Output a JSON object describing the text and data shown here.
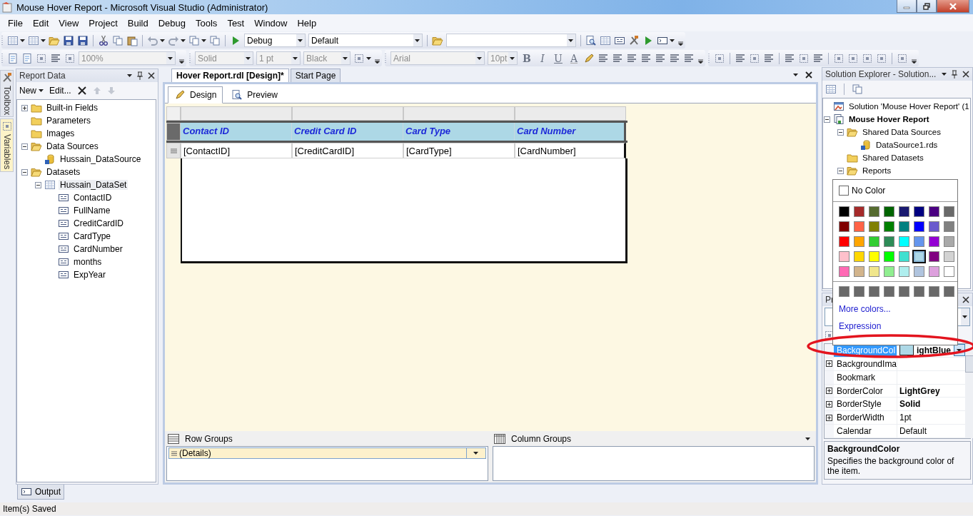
{
  "window": {
    "title": "Mouse Hover Report - Microsoft Visual Studio (Administrator)"
  },
  "menu": [
    "File",
    "Edit",
    "View",
    "Project",
    "Build",
    "Debug",
    "Tools",
    "Test",
    "Window",
    "Help"
  ],
  "toolbar": {
    "combos": [
      {
        "value": "Debug",
        "disabled": false
      },
      {
        "value": "Default",
        "disabled": false
      },
      {
        "value": "100%",
        "disabled": true
      },
      {
        "value": "Solid",
        "disabled": true
      },
      {
        "value": "1 pt",
        "disabled": true
      },
      {
        "value": "Black",
        "disabled": true
      },
      {
        "value": "Arial",
        "disabled": true
      },
      {
        "value": "10pt",
        "disabled": true
      }
    ],
    "format_buttons": [
      {
        "label": "B",
        "kind": "bold"
      },
      {
        "label": "I",
        "kind": "italic"
      },
      {
        "label": "U",
        "kind": "underline"
      },
      {
        "label": "A",
        "kind": "color"
      }
    ]
  },
  "side_tabs": [
    {
      "label": "Toolbox",
      "selected": false
    },
    {
      "label": "Variables",
      "selected": true
    }
  ],
  "report_data": {
    "title": "Report Data",
    "actions": [
      {
        "label": "New",
        "dropdown": true
      },
      {
        "label": "Edit...",
        "dropdown": false
      }
    ],
    "tree": [
      {
        "label": "Built-in Fields",
        "kind": "folder",
        "expanded": false,
        "selected": false
      },
      {
        "label": "Parameters",
        "kind": "folder",
        "selected": false
      },
      {
        "label": "Images",
        "kind": "folder",
        "selected": false
      },
      {
        "label": "Data Sources",
        "kind": "openfolder",
        "expanded": true,
        "selected": false,
        "children": [
          {
            "label": "Hussain_DataSource",
            "kind": "datasource",
            "selected": false
          }
        ]
      },
      {
        "label": "Datasets",
        "kind": "openfolder",
        "expanded": true,
        "selected": false,
        "children": [
          {
            "label": "Hussain_DataSet",
            "kind": "dataset",
            "expanded": true,
            "selected": true,
            "children": [
              {
                "label": "ContactID",
                "kind": "field",
                "selected": false
              },
              {
                "label": "FullName",
                "kind": "field",
                "selected": false
              },
              {
                "label": "CreditCardID",
                "kind": "field",
                "selected": false
              },
              {
                "label": "CardType",
                "kind": "field",
                "selected": false
              },
              {
                "label": "CardNumber",
                "kind": "field",
                "selected": false
              },
              {
                "label": "months",
                "kind": "field",
                "selected": false
              },
              {
                "label": "ExpYear",
                "kind": "field",
                "selected": false
              }
            ]
          }
        ]
      }
    ]
  },
  "document": {
    "tabs": [
      {
        "label": "Hover Report.rdl [Design]*",
        "selected": true
      },
      {
        "label": "Start Page",
        "selected": false
      }
    ],
    "view_tabs": [
      {
        "label": "Design",
        "selected": true
      },
      {
        "label": "Preview",
        "selected": false
      }
    ],
    "table": {
      "columns": [
        {
          "header": "Contact ID",
          "field": "[ContactID]"
        },
        {
          "header": "Credit Card ID",
          "field": "[CreditCardID]"
        },
        {
          "header": "Card Type",
          "field": "[CardType]"
        },
        {
          "header": "Card Number",
          "field": "[CardNumber]"
        }
      ]
    },
    "row_groups": {
      "title": "Row Groups",
      "items": [
        "(Details)"
      ]
    },
    "column_groups": {
      "title": "Column Groups"
    }
  },
  "solution_explorer": {
    "title": "Solution Explorer - Solution...",
    "tree": [
      {
        "label": "Solution 'Mouse Hover Report' (1",
        "kind": "solution",
        "selected": false
      },
      {
        "label": "Mouse Hover Report",
        "kind": "project",
        "expanded": true,
        "selected": false,
        "children": [
          {
            "label": "Shared Data Sources",
            "kind": "openfolder",
            "expanded": true,
            "selected": false,
            "children": [
              {
                "label": "DataSource1.rds",
                "kind": "database",
                "selected": false
              }
            ]
          },
          {
            "label": "Shared Datasets",
            "kind": "folder",
            "selected": false
          },
          {
            "label": "Reports",
            "kind": "openfolder",
            "expanded": true,
            "selected": false
          }
        ]
      }
    ]
  },
  "properties": {
    "title": "Pr",
    "rows": [
      {
        "name": "BackgroundCol",
        "value": "ightBlue",
        "kind": "color",
        "color": "#add8e6",
        "bold": true,
        "expandable": false,
        "selected": true
      },
      {
        "name": "BackgroundIma",
        "kind": "text",
        "expandable": true,
        "selected": false
      },
      {
        "name": "Bookmark",
        "kind": "text",
        "expandable": false,
        "selected": false
      },
      {
        "name": "BorderColor",
        "value": "LightGrey",
        "kind": "text",
        "bold": true,
        "expandable": true,
        "selected": false
      },
      {
        "name": "BorderStyle",
        "value": "Solid",
        "kind": "text",
        "bold": true,
        "expandable": true,
        "selected": false
      },
      {
        "name": "BorderWidth",
        "value": "1pt",
        "kind": "text",
        "bold": false,
        "expandable": true,
        "selected": false
      },
      {
        "name": "Calendar",
        "value": "Default",
        "kind": "text",
        "bold": false,
        "expandable": false,
        "selected": false
      }
    ],
    "description": {
      "title": "BackgroundColor",
      "text": "Specifies the background color of the item."
    }
  },
  "color_picker": {
    "no_color": "No Color",
    "swatches": [
      {
        "color": "#000000",
        "selected": false
      },
      {
        "color": "#a52a2a",
        "selected": false
      },
      {
        "color": "#556b2f",
        "selected": false
      },
      {
        "color": "#006400",
        "selected": false
      },
      {
        "color": "#191970",
        "selected": false
      },
      {
        "color": "#000080",
        "selected": false
      },
      {
        "color": "#4b0082",
        "selected": false
      },
      {
        "color": "#696969",
        "selected": false
      },
      {
        "color": "#800000",
        "selected": false
      },
      {
        "color": "#ff6347",
        "selected": false
      },
      {
        "color": "#808000",
        "selected": false
      },
      {
        "color": "#008000",
        "selected": false
      },
      {
        "color": "#008080",
        "selected": false
      },
      {
        "color": "#0000ff",
        "selected": false
      },
      {
        "color": "#6a5acd",
        "selected": false
      },
      {
        "color": "#808080",
        "selected": false
      },
      {
        "color": "#ff0000",
        "selected": false
      },
      {
        "color": "#ffa500",
        "selected": false
      },
      {
        "color": "#32cd32",
        "selected": false
      },
      {
        "color": "#2e8b57",
        "selected": false
      },
      {
        "color": "#00ffff",
        "selected": false
      },
      {
        "color": "#6495ed",
        "selected": false
      },
      {
        "color": "#9400d3",
        "selected": false
      },
      {
        "color": "#a9a9a9",
        "selected": false
      },
      {
        "color": "#ffc0cb",
        "selected": false
      },
      {
        "color": "#ffd700",
        "selected": false
      },
      {
        "color": "#ffff00",
        "selected": false
      },
      {
        "color": "#00ff00",
        "selected": false
      },
      {
        "color": "#40e0d0",
        "selected": false
      },
      {
        "color": "#add8e6",
        "selected": true
      },
      {
        "color": "#800080",
        "selected": false
      },
      {
        "color": "#d3d3d3",
        "selected": false
      },
      {
        "color": "#ff69b4",
        "selected": false
      },
      {
        "color": "#d2b48c",
        "selected": false
      },
      {
        "color": "#f0e68c",
        "selected": false
      },
      {
        "color": "#90ee90",
        "selected": false
      },
      {
        "color": "#afeeee",
        "selected": false
      },
      {
        "color": "#b0c4de",
        "selected": false
      },
      {
        "color": "#dda0dd",
        "selected": false
      },
      {
        "color": "#ffffff",
        "selected": false
      }
    ],
    "links": [
      "More colors...",
      "Expression"
    ]
  },
  "bottom_tabs": [
    "Output"
  ],
  "status_bar": "Item(s) Saved"
}
